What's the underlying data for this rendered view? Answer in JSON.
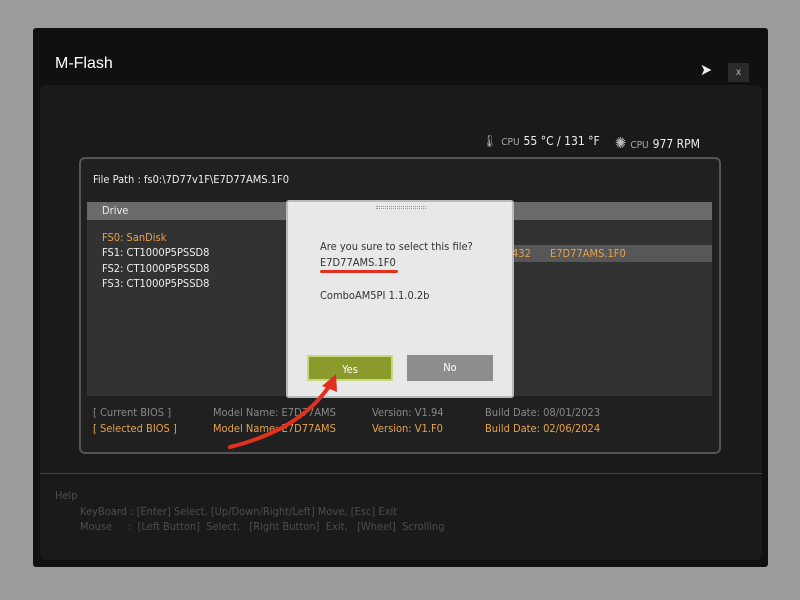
{
  "window": {
    "title": "M-Flash",
    "close_label": "x"
  },
  "status": {
    "temp_label": "CPU",
    "temp_value": "55 °C / 131 °F",
    "fan_label": "CPU",
    "fan_value": "977 RPM"
  },
  "file_path": "File Path :  fs0:\\7D77v1F\\E7D77AMS.1F0",
  "drive_header": "Drive",
  "drives": [
    "FS0: SanDisk",
    "FS1: CT1000P5PSSD8",
    "FS2: CT1000P5PSSD8",
    "FS3: CT1000P5PSSD8"
  ],
  "selected_file": {
    "size_partial": "432",
    "name": "E7D77AMS.1F0"
  },
  "bios": {
    "current": {
      "label": "[ Current BIOS  ]",
      "model": "Model Name: E7D77AMS",
      "version": "Version: V1.94",
      "date": "Build Date: 08/01/2023"
    },
    "selected": {
      "label": "[ Selected BIOS ]",
      "model": "Model Name: E7D77AMS",
      "version": "Version: V1.F0",
      "date": "Build Date: 02/06/2024"
    }
  },
  "help": {
    "title": "Help",
    "keyboard": "KeyBoard :  [Enter]  Select,   [Up/Down/Right/Left]  Move,   [Esc]  Exit",
    "mouse": "Mouse     :  [Left Button]  Select,   [Right Button]  Exit,   [Wheel]  Scrolling"
  },
  "dialog": {
    "question": "Are you sure to select this file?",
    "filename": "E7D77AMS.1F0",
    "version": "ComboAM5PI 1.1.0.2b",
    "yes": "Yes",
    "no": "No"
  },
  "colors": {
    "accent": "#e7a24e",
    "yes_button": "#8a9b2c",
    "annotation": "#e0301e"
  }
}
